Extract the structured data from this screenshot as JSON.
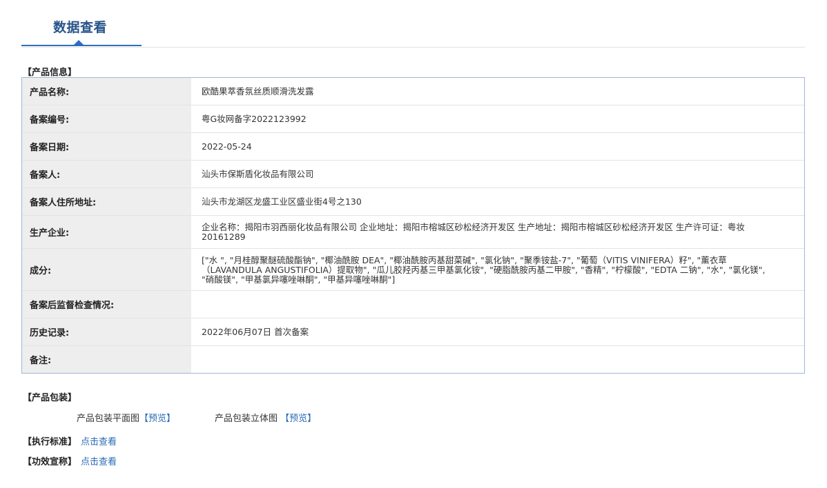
{
  "header": {
    "tab_title": "数据查看"
  },
  "product_info": {
    "section_title": "【产品信息】",
    "rows": [
      {
        "label": "产品名称:",
        "value": "欧酷果萃香氛丝质顺滑洗发露"
      },
      {
        "label": "备案编号:",
        "value": "粤G妆网备字2022123992"
      },
      {
        "label": "备案日期:",
        "value": "2022-05-24"
      },
      {
        "label": "备案人:",
        "value": "汕头市保斯盾化妆品有限公司"
      },
      {
        "label": "备案人住所地址:",
        "value": "汕头市龙湖区龙盛工业区盛业街4号之130"
      },
      {
        "label": "生产企业:",
        "value": "企业名称：揭阳市羽西丽化妆品有限公司 企业地址：揭阳市榕城区砂松经济开发区 生产地址：揭阳市榕城区砂松经济开发区 生产许可证：粤妆20161289"
      },
      {
        "label": "成分:",
        "value": "[\"水 \", \"月桂醇聚醚硫酸酯钠\", \"椰油酰胺 DEA\", \"椰油酰胺丙基甜菜碱\", \"氯化钠\", \"聚季铵盐-7\", \"葡萄（VITIS VINIFERA）籽\", \"薰衣草（LAVANDULA ANGUSTIFOLIA）提取物\", \"瓜儿胶羟丙基三甲基氯化铵\", \"硬脂酰胺丙基二甲胺\", \"香精\", \"柠檬酸\", \"EDTA 二钠\", \"水\", \"氯化镁\", \"硝酸镁\", \"甲基氯异噻唑啉酮\", \"甲基异噻唑啉酮\"]"
      },
      {
        "label": "备案后监督检查情况:",
        "value": ""
      },
      {
        "label": "历史记录:",
        "value": "2022年06月07日 首次备案"
      },
      {
        "label": "备注:",
        "value": ""
      }
    ]
  },
  "packaging": {
    "section_title": "【产品包装】",
    "flat_label": "产品包装平面图",
    "flat_link": "【预览】",
    "solid_label": "产品包装立体图",
    "solid_link": "【预览】"
  },
  "standard": {
    "label": "【执行标准】",
    "link": "点击查看"
  },
  "efficacy": {
    "label": "【功效宣称】",
    "link": "点击查看"
  },
  "colors": {
    "accent": "#2c6cbf",
    "title": "#27548a",
    "link": "#2a6ab5",
    "table_border": "#9fb6d6",
    "label_bg": "#eeeeee"
  }
}
